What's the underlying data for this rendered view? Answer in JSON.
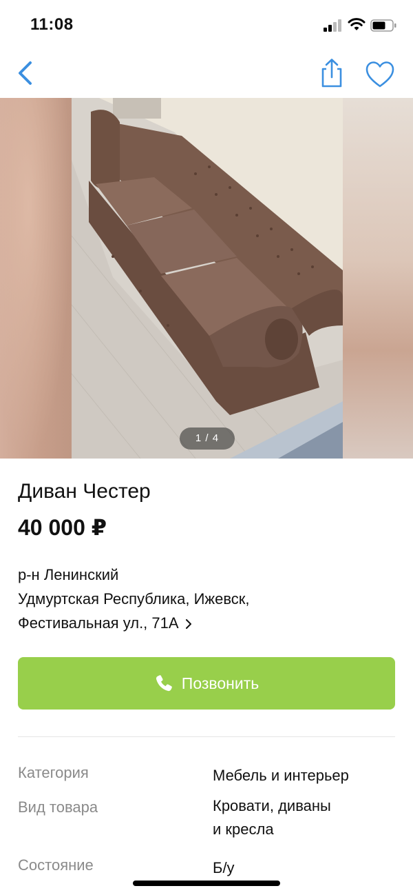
{
  "status_bar": {
    "time": "11:08"
  },
  "gallery": {
    "counter": "1 / 4"
  },
  "listing": {
    "title": "Диван Честер",
    "price": "40 000 ₽",
    "address": {
      "district": "р-н Ленинский",
      "region_city": "Удмуртская Республика, Ижевск,",
      "street": "Фестивальная ул., 71А"
    },
    "call_label": "Позвонить"
  },
  "params": [
    {
      "key": "Категория",
      "value": "Мебель и интерьер"
    },
    {
      "key": "Вид товара",
      "value_line1": "Кровати, диваны",
      "value_line2": "и кресла"
    },
    {
      "key": "Состояние",
      "value": "Б/у"
    }
  ],
  "colors": {
    "accent": "#3b8fe0",
    "call_button": "#98cf4b",
    "muted_text": "#8a8a8a"
  },
  "icons": {
    "back": "back-chevron-icon",
    "share": "share-icon",
    "favorite": "heart-icon",
    "call": "phone-icon"
  }
}
